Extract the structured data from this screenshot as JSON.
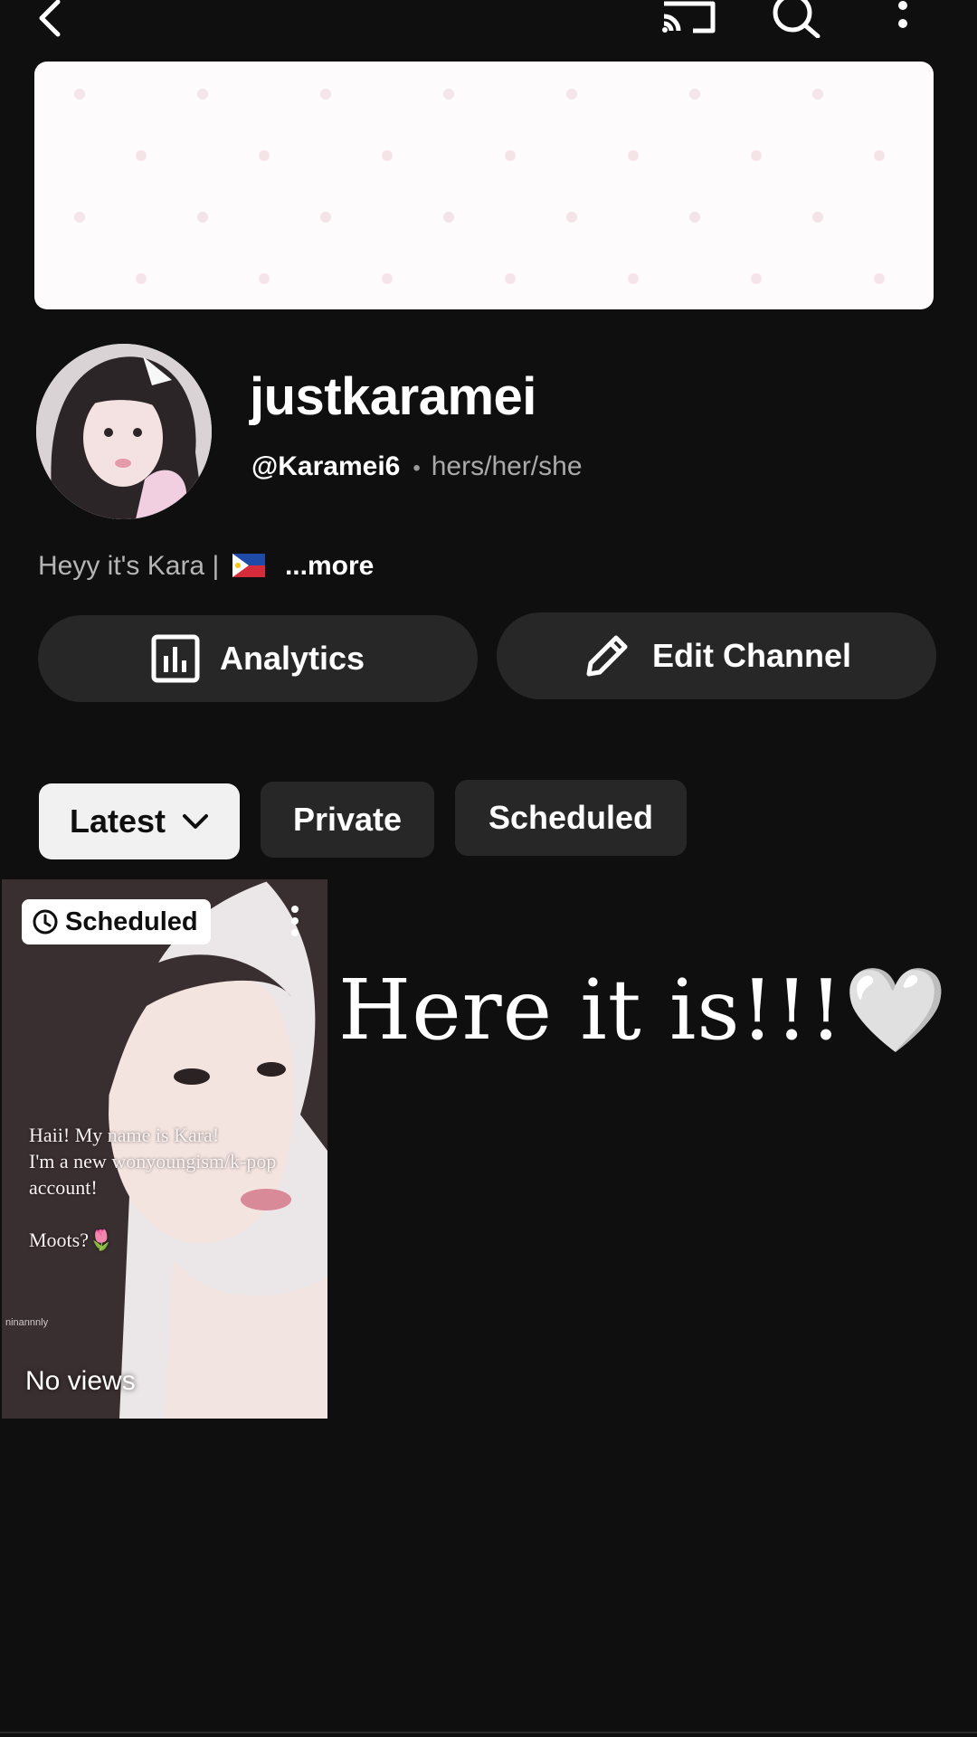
{
  "topbar": {
    "back_icon": "back-arrow-icon",
    "cast_icon": "cast-icon",
    "search_icon": "search-icon",
    "more_icon": "more-vert-icon"
  },
  "channel": {
    "name": "justkaramei",
    "handle": "@Karamei6",
    "separator": "•",
    "pronouns": "hers/her/she",
    "bio": "Heyy it's Kara |",
    "bio_more": "...more"
  },
  "actions": {
    "analytics_label": "Analytics",
    "edit_label": "Edit Channel"
  },
  "filters": [
    {
      "label": "Latest",
      "selected": true
    },
    {
      "label": "Private",
      "selected": false
    },
    {
      "label": "Scheduled",
      "selected": false
    }
  ],
  "video": {
    "badge": "Scheduled",
    "text_lines": [
      "Haii! My name is Kara!",
      "I'm a new wonyoungism/k-pop account!",
      "Moots?🌷"
    ],
    "watermark": "ninannnly",
    "views": "No views"
  },
  "overlay_caption": "Here it is!!!🤍",
  "colors": {
    "background": "#0f0f10",
    "button_bg": "#272727",
    "chip_selected_bg": "#f1f1f1",
    "secondary_text": "#aaaaaa"
  }
}
